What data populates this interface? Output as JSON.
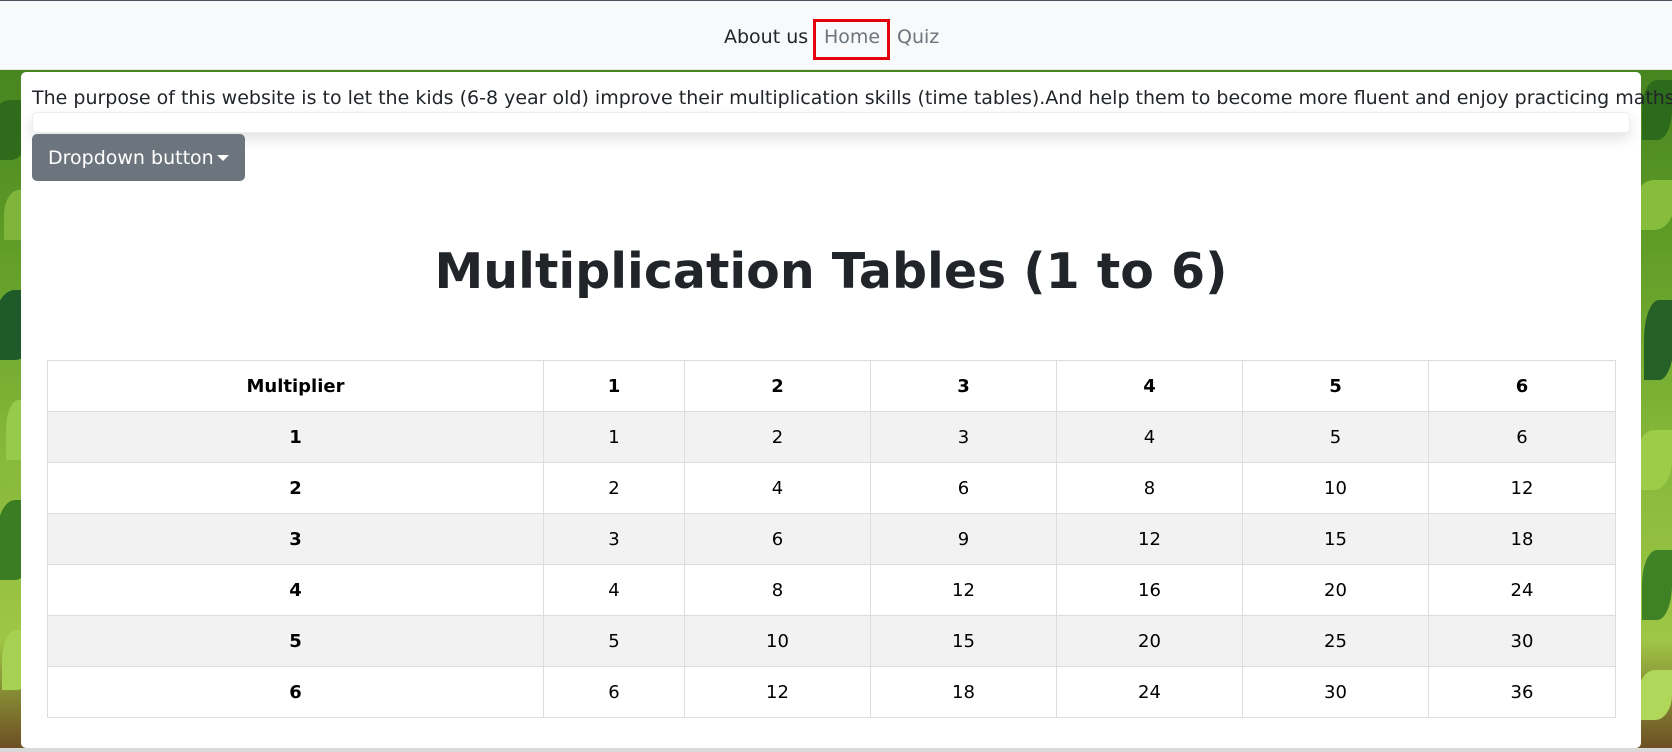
{
  "nav": {
    "about_label": "About us",
    "home_label": "Home",
    "quiz_label": "Quiz"
  },
  "intro_text": "The purpose of this website is to let the kids (6-8 year old) improve their multiplication skills (time tables).And help them to become more fluent and enjoy practicing maths.",
  "dropdown": {
    "label": "Dropdown button"
  },
  "heading": "Multiplication Tables (1 to 6)",
  "table": {
    "headers": [
      "Multiplier",
      "1",
      "2",
      "3",
      "4",
      "5",
      "6"
    ],
    "rows": [
      [
        "1",
        "1",
        "2",
        "3",
        "4",
        "5",
        "6"
      ],
      [
        "2",
        "2",
        "4",
        "6",
        "8",
        "10",
        "12"
      ],
      [
        "3",
        "3",
        "6",
        "9",
        "12",
        "15",
        "18"
      ],
      [
        "4",
        "4",
        "8",
        "12",
        "16",
        "20",
        "24"
      ],
      [
        "5",
        "5",
        "10",
        "15",
        "20",
        "25",
        "30"
      ],
      [
        "6",
        "6",
        "12",
        "18",
        "24",
        "30",
        "36"
      ]
    ]
  },
  "colors": {
    "highlight": "#e3000b",
    "button_bg": "#6c757d",
    "navbar_bg": "#f8f9fa"
  }
}
